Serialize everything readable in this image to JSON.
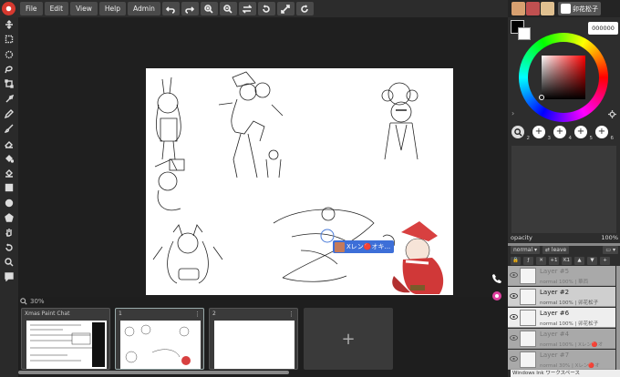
{
  "menu": {
    "file": "File",
    "edit": "Edit",
    "view": "View",
    "help": "Help",
    "admin": "Admin"
  },
  "toolbar_icons": [
    "move-icon",
    "rect-select-icon",
    "ellipse-select-icon",
    "lasso-icon",
    "transform-icon",
    "eyedropper-icon",
    "pen-icon",
    "brush-icon",
    "eraser-icon",
    "bucket-icon",
    "gradient-icon",
    "rect-icon",
    "circle-icon",
    "polygon-icon",
    "hand-icon",
    "rotate-icon",
    "zoom-icon",
    "chat-icon"
  ],
  "canvas": {
    "zoom": "30%",
    "user_tag": "Xレン🔴オキ..."
  },
  "pages": [
    {
      "label": "Xmas Paint Chat",
      "selected": false
    },
    {
      "label": "1",
      "selected": true
    },
    {
      "label": "2",
      "selected": false
    }
  ],
  "add_page": "+",
  "users": {
    "current_name": "卯花松子"
  },
  "color": {
    "hex": "000000",
    "primary": "#000000",
    "secondary": "#ffffff"
  },
  "brushes": [
    {
      "num": "2"
    },
    {
      "num": "3"
    },
    {
      "num": "4"
    },
    {
      "num": "5"
    },
    {
      "num": "6"
    }
  ],
  "opacity": {
    "label": "opacity",
    "value": "100%"
  },
  "blend": {
    "mode": "normal",
    "leave": "leave"
  },
  "layer_tools": [
    "+1",
    "K1"
  ],
  "layers": [
    {
      "name": "Layer #5",
      "info": "normal 100% | 華西",
      "state": "dim"
    },
    {
      "name": "Layer #2",
      "info": "normal 100% | 卯花松子",
      "state": "normal"
    },
    {
      "name": "Layer #6",
      "info": "normal 100% | 卯花松子",
      "state": "selected"
    },
    {
      "name": "Layer #4",
      "info": "normal 100% | Xレン🔴オ",
      "state": "dim"
    },
    {
      "name": "Layer #7",
      "info": "normal 30% | Xレン🔴オ",
      "state": "dim"
    }
  ],
  "footer": "Windows Ink ワークスペース"
}
